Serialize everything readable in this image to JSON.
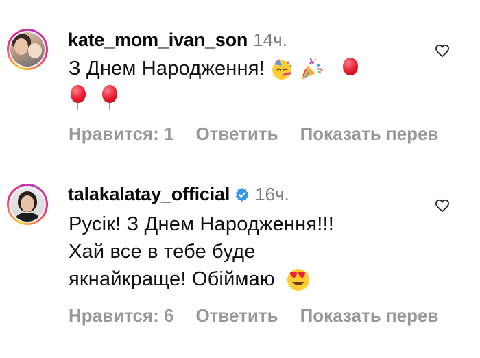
{
  "comments": [
    {
      "username": "kate_mom_ivan_son",
      "time": "14ч.",
      "text": "З Днем Народження!",
      "verified": false,
      "emojis": [
        "partying-face-icon",
        "party-popper-icon",
        "balloon-icon",
        "balloon-icon",
        "balloon-icon"
      ],
      "likes_label": "Нравится: 1",
      "reply_label": "Ответить",
      "translate_label": "Показать перев"
    },
    {
      "username": "talakalatay_official",
      "time": "16ч.",
      "text_lines": [
        "Русік! З Днем Народження!!!",
        "Хай все в тебе буде",
        "якнайкраще! Обіймаю"
      ],
      "verified": true,
      "emojis": [
        "heart-eyes-icon"
      ],
      "likes_label": "Нравится: 6",
      "reply_label": "Ответить",
      "translate_label": "Показать перев"
    }
  ],
  "colors": {
    "accent_verified": "#3797f0",
    "muted": "#98989c",
    "time": "#7c7c80"
  }
}
